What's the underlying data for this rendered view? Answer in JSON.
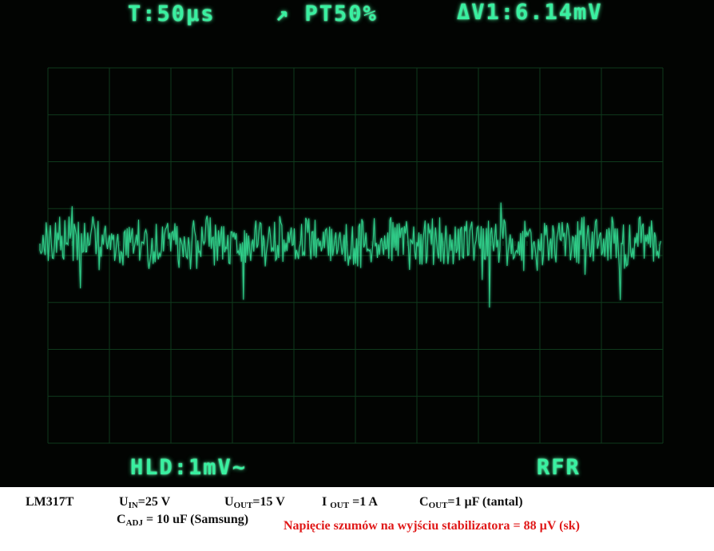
{
  "scope": {
    "timebase": "T:50µs",
    "trigger": "↗ PT50%",
    "delta_v": "ΔV1:6.14mV",
    "hold": "HLD:1mV~",
    "mode": "RFR",
    "trace_color": "#39f0a0",
    "graticule_color": "#0f3a1c",
    "background_color": "#020402"
  },
  "caption": {
    "device": "LM317T",
    "u_in": {
      "symbol": "U",
      "sub": "IN",
      "value": "=25 V"
    },
    "u_out": {
      "symbol": "U",
      "sub": "OUT",
      "value": "=15 V"
    },
    "i_out": {
      "symbol": "I",
      "sub": "OUT",
      "value": "=1 A"
    },
    "c_out": {
      "symbol": "C",
      "sub": "OUT",
      "value": "=1 µF (tantal)"
    },
    "c_adj": {
      "symbol": "C",
      "sub": "ADJ",
      "value": "= 10 uF (Samsung)"
    },
    "noise_note": "Napięcie szumów na wyjściu stabilizatora = 88 µV (sk)",
    "noise_color": "#e01818"
  }
}
